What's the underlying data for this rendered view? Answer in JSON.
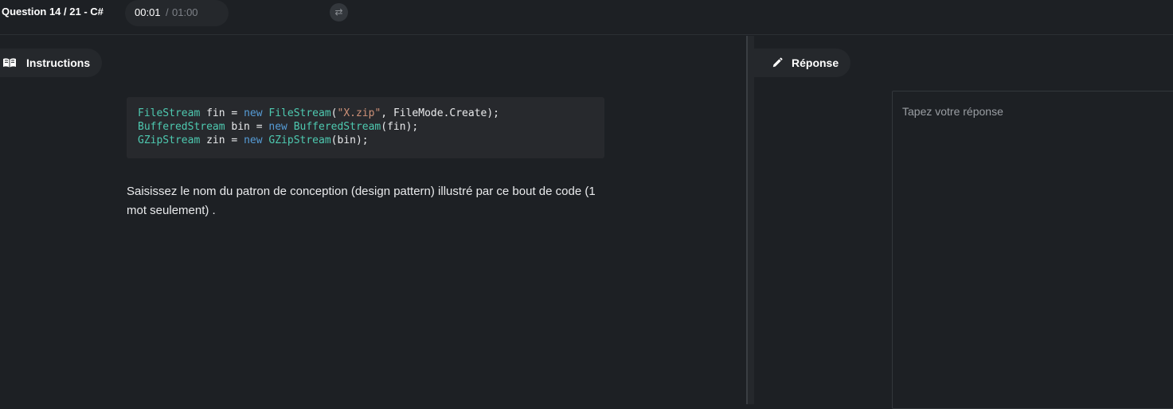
{
  "header": {
    "question_title": "Question 14 / 21 - C#",
    "timer_elapsed": "00:01",
    "timer_separator": "/",
    "timer_total": "01:00",
    "swap_icon": "swap-arrows-icon"
  },
  "instructions": {
    "tab_label": "Instructions",
    "tab_icon": "book-open-icon",
    "code_lines": [
      [
        {
          "t": "type",
          "v": "FileStream"
        },
        {
          "t": "plain",
          "v": " fin = "
        },
        {
          "t": "kw",
          "v": "new"
        },
        {
          "t": "plain",
          "v": " "
        },
        {
          "t": "type",
          "v": "FileStream"
        },
        {
          "t": "plain",
          "v": "("
        },
        {
          "t": "str",
          "v": "\"X.zip\""
        },
        {
          "t": "plain",
          "v": ", FileMode.Create);"
        }
      ],
      [
        {
          "t": "type",
          "v": "BufferedStream"
        },
        {
          "t": "plain",
          "v": " bin = "
        },
        {
          "t": "kw",
          "v": "new"
        },
        {
          "t": "plain",
          "v": " "
        },
        {
          "t": "type",
          "v": "BufferedStream"
        },
        {
          "t": "plain",
          "v": "(fin);"
        }
      ],
      [
        {
          "t": "type",
          "v": "GZipStream"
        },
        {
          "t": "plain",
          "v": " zin = "
        },
        {
          "t": "kw",
          "v": "new"
        },
        {
          "t": "plain",
          "v": " "
        },
        {
          "t": "type",
          "v": "GZipStream"
        },
        {
          "t": "plain",
          "v": "(bin);"
        }
      ]
    ],
    "question_text": "Saisissez le nom du patron de conception (design pattern) illustré par ce bout de code (1 mot seulement) ."
  },
  "response": {
    "tab_label": "Réponse",
    "tab_icon": "pencil-icon",
    "answer_value": "",
    "answer_placeholder": "Tapez votre réponse"
  },
  "colors": {
    "background": "#1d2024",
    "panel": "#25282c",
    "code_background": "#27292d",
    "code_type": "#4ec9b0",
    "code_keyword": "#569cd6",
    "code_string": "#ce9178"
  }
}
